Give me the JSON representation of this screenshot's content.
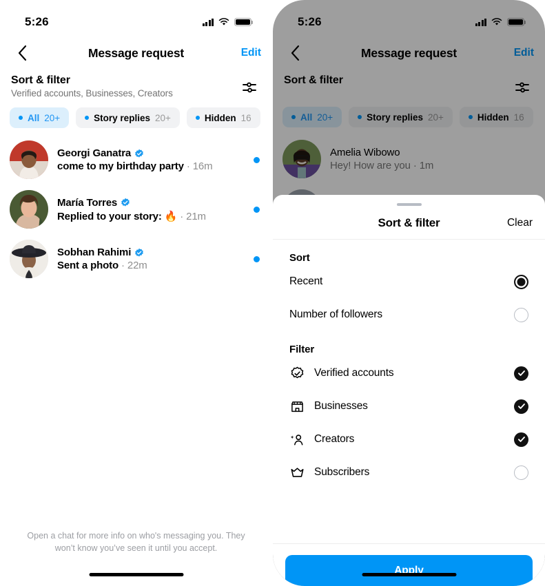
{
  "status_bar": {
    "time": "5:26",
    "signal_icon": "cellular-signal-icon",
    "wifi_icon": "wifi-icon",
    "battery_icon": "battery-full-icon"
  },
  "nav": {
    "back_icon": "chevron-left-icon",
    "title": "Message request",
    "edit_label": "Edit"
  },
  "sort_filter_header": {
    "title": "Sort & filter",
    "subtitle": "Verified accounts, Businesses, Creators",
    "sliders_icon": "sliders-icon"
  },
  "chips": [
    {
      "label": "All",
      "count": "20+",
      "active": true
    },
    {
      "label": "Story replies",
      "count": "20+",
      "active": false
    },
    {
      "label": "Hidden",
      "count": "16",
      "active": false
    }
  ],
  "messages_left": [
    {
      "name": "Georgi Ganatra",
      "verified": true,
      "preview": "come to my birthday party",
      "time": "16m",
      "unread": true,
      "bold": true,
      "avatar_colors": [
        "#c0392b",
        "#e8dcd0",
        "#7a4b33"
      ]
    },
    {
      "name": "María Torres",
      "verified": true,
      "preview": "Replied to your story: 🔥",
      "time": "21m",
      "unread": true,
      "bold": true,
      "avatar_colors": [
        "#4a2f1c",
        "#e8b79a",
        "#3d5030"
      ]
    },
    {
      "name": "Sobhan Rahimi",
      "verified": true,
      "preview": "Sent a photo",
      "time": "22m",
      "unread": true,
      "bold": true,
      "avatar_colors": [
        "#2b2b2f",
        "#8a6247",
        "#f0ece6"
      ]
    }
  ],
  "messages_right": [
    {
      "name": "Amelia Wibowo",
      "verified": false,
      "preview": "Hey! How are you",
      "time": "1m",
      "unread": false,
      "bold": false,
      "avatar_colors": [
        "#6b8f4e",
        "#6b4f9e",
        "#4a3027"
      ]
    }
  ],
  "footnote": "Open a chat for more info on who's messaging you. They won’t know you’ve seen it until you accept.",
  "sheet": {
    "grabber": "drag-handle",
    "title": "Sort & filter",
    "clear_label": "Clear",
    "sort_group_title": "Sort",
    "sort_options": [
      {
        "label": "Recent",
        "selected": true
      },
      {
        "label": "Number of followers",
        "selected": false
      }
    ],
    "filter_group_title": "Filter",
    "filter_options": [
      {
        "label": "Verified accounts",
        "icon": "verified-badge-icon",
        "checked": true
      },
      {
        "label": "Businesses",
        "icon": "storefront-icon",
        "checked": true
      },
      {
        "label": "Creators",
        "icon": "creator-person-star-icon",
        "checked": true
      },
      {
        "label": "Subscribers",
        "icon": "crown-icon",
        "checked": false
      }
    ],
    "apply_label": "Apply"
  },
  "colors": {
    "accent_blue": "#0095F6",
    "chip_active_bg": "#DCEFFC",
    "chip_bg": "#F1F2F4",
    "muted_text": "#8E8E8E",
    "dark": "#111111"
  }
}
